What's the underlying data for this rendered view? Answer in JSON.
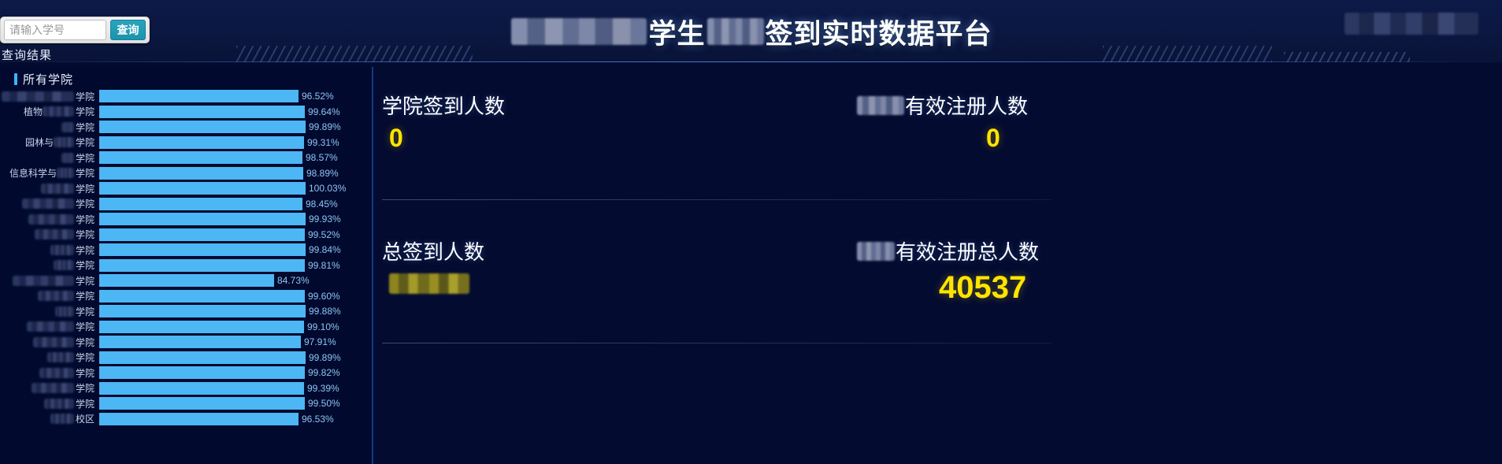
{
  "header": {
    "title_prefix_redacted": true,
    "title_part1": "学生",
    "title_mid_redacted": true,
    "title_part2": "签到实时数据平台",
    "right_badge_redacted": true
  },
  "search": {
    "placeholder": "请输入学号",
    "value": "",
    "button_label": "查询"
  },
  "result_label": "查询结果",
  "left_panel": {
    "title": "所有学院",
    "title_accent_color": "#3ab6ff"
  },
  "stats": [
    {
      "id": "college-signin-count",
      "label": "学院签到人数",
      "label_redacted": false,
      "value": "0",
      "value_redacted": false
    },
    {
      "id": "valid-registration-count",
      "label": "有效注册人数",
      "label_redacted": true,
      "value": "0",
      "value_redacted": false
    },
    {
      "id": "total-signin-count",
      "label": "总签到人数",
      "label_redacted": false,
      "value": "",
      "value_redacted": true
    },
    {
      "id": "total-valid-registration-count",
      "label": "有效注册总人数",
      "label_redacted": true,
      "value": "40537",
      "value_redacted": false
    }
  ],
  "chart_data": {
    "type": "bar",
    "orientation": "horizontal",
    "title": "所有学院",
    "xlabel": "",
    "ylabel": "",
    "xlim": [
      0,
      100.03
    ],
    "grid": false,
    "legend": false,
    "bar_color": "#4db6f5",
    "value_label_color": "#8fc4f5",
    "value_suffix": "%",
    "categories": [
      "████学院",
      "植物███学院",
      "█████学院",
      "园林与███学院",
      "█████学院",
      "信息科学与███学院",
      "█████学院",
      "█████学院",
      "█████学院",
      "█████学院",
      "█████学院",
      "█████学院",
      "█████学院",
      "█████学院",
      "█████学院",
      "█████学院",
      "█████学院",
      "█████学院",
      "█████学院",
      "█████学院",
      "███校区"
    ],
    "category_labels_redacted": true,
    "values": [
      96.52,
      99.64,
      99.89,
      99.31,
      98.57,
      98.89,
      100.03,
      98.45,
      99.93,
      99.52,
      99.84,
      99.81,
      84.73,
      99.6,
      99.88,
      99.1,
      97.91,
      99.89,
      99.82,
      99.39,
      99.5,
      96.53
    ],
    "value_labels": [
      "96.52%",
      "99.64%",
      "99.89%",
      "99.31%",
      "98.57%",
      "98.89%",
      "100.03%",
      "98.45%",
      "99.93%",
      "99.52%",
      "99.84%",
      "99.81%",
      "84.73%",
      "99.60%",
      "99.88%",
      "99.10%",
      "97.91%",
      "99.89%",
      "99.82%",
      "99.39%",
      "99.50%",
      "96.53%"
    ],
    "rows": [
      {
        "label_suffix": "学院",
        "label_prefix": "",
        "redact_w": 92,
        "value": 96.52,
        "label": "96.52%"
      },
      {
        "label_suffix": "学院",
        "label_prefix": "植物",
        "redact_w": 40,
        "value": 99.64,
        "label": "99.64%"
      },
      {
        "label_suffix": "学院",
        "label_prefix": "",
        "redact_w": 16,
        "value": 99.89,
        "label": "99.89%"
      },
      {
        "label_suffix": "学院",
        "label_prefix": "园林与",
        "redact_w": 26,
        "value": 99.31,
        "label": "99.31%"
      },
      {
        "label_suffix": "学院",
        "label_prefix": "",
        "redact_w": 16,
        "value": 98.57,
        "label": "98.57%"
      },
      {
        "label_suffix": "学院",
        "label_prefix": "信息科学与",
        "redact_w": 22,
        "value": 98.89,
        "label": "98.89%"
      },
      {
        "label_suffix": "学院",
        "label_prefix": "",
        "redact_w": 42,
        "value": 100.03,
        "label": "100.03%"
      },
      {
        "label_suffix": "学院",
        "label_prefix": "",
        "redact_w": 66,
        "value": 98.45,
        "label": "98.45%"
      },
      {
        "label_suffix": "学院",
        "label_prefix": "",
        "redact_w": 58,
        "value": 99.93,
        "label": "99.93%"
      },
      {
        "label_suffix": "学院",
        "label_prefix": "",
        "redact_w": 50,
        "value": 99.52,
        "label": "99.52%"
      },
      {
        "label_suffix": "学院",
        "label_prefix": "",
        "redact_w": 30,
        "value": 99.84,
        "label": "99.84%"
      },
      {
        "label_suffix": "学院",
        "label_prefix": "",
        "redact_w": 26,
        "value": 99.81,
        "label": "99.81%"
      },
      {
        "label_suffix": "学院",
        "label_prefix": "",
        "redact_w": 78,
        "value": 84.73,
        "label": "84.73%"
      },
      {
        "label_suffix": "学院",
        "label_prefix": "",
        "redact_w": 46,
        "value": 99.6,
        "label": "99.60%"
      },
      {
        "label_suffix": "学院",
        "label_prefix": "",
        "redact_w": 24,
        "value": 99.88,
        "label": "99.88%"
      },
      {
        "label_suffix": "学院",
        "label_prefix": "",
        "redact_w": 60,
        "value": 99.1,
        "label": "99.10%"
      },
      {
        "label_suffix": "学院",
        "label_prefix": "",
        "redact_w": 52,
        "value": 97.91,
        "label": "97.91%"
      },
      {
        "label_suffix": "学院",
        "label_prefix": "",
        "redact_w": 34,
        "value": 99.89,
        "label": "99.89%"
      },
      {
        "label_suffix": "学院",
        "label_prefix": "",
        "redact_w": 44,
        "value": 99.82,
        "label": "99.82%"
      },
      {
        "label_suffix": "学院",
        "label_prefix": "",
        "redact_w": 54,
        "value": 99.39,
        "label": "99.39%"
      },
      {
        "label_suffix": "学院",
        "label_prefix": "",
        "redact_w": 38,
        "value": 99.5,
        "label": "99.50%"
      },
      {
        "label_suffix": "校区",
        "label_prefix": "",
        "redact_w": 30,
        "value": 96.53,
        "label": "96.53%"
      }
    ]
  },
  "colors": {
    "background": "#040b30",
    "panel": "#010a2e",
    "header_grad_top": "#0d1a48",
    "accent_blue": "#3ab6ff",
    "bar_blue": "#4db6f5",
    "value_yellow": "#ffe400",
    "button_teal": "#2aa4bd"
  }
}
